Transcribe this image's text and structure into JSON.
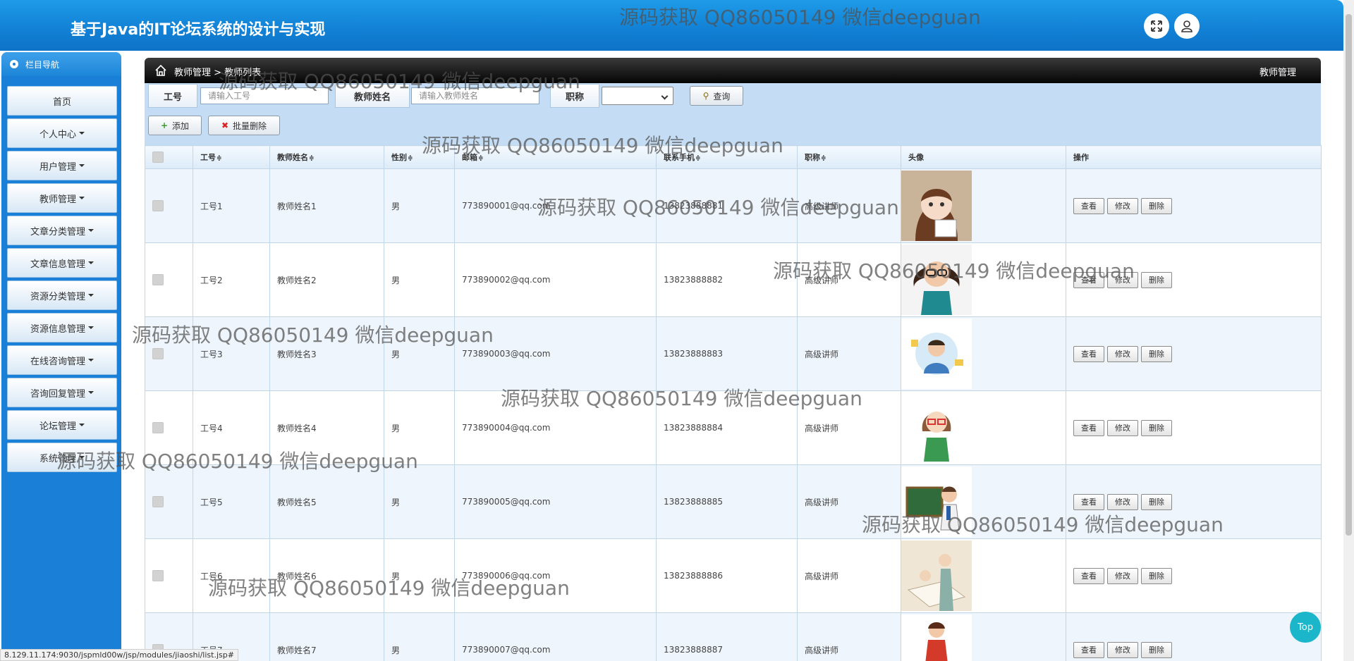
{
  "app": {
    "title": "基于Java的IT论坛系统的设计与实现"
  },
  "header": {
    "icons": [
      "expand-icon",
      "user-icon"
    ]
  },
  "sidebar": {
    "heading": "栏目导航",
    "items": [
      {
        "label": "首页",
        "has_caret": false
      },
      {
        "label": "个人中心",
        "has_caret": true
      },
      {
        "label": "用户管理",
        "has_caret": true
      },
      {
        "label": "教师管理",
        "has_caret": true
      },
      {
        "label": "文章分类管理",
        "has_caret": true
      },
      {
        "label": "文章信息管理",
        "has_caret": true
      },
      {
        "label": "资源分类管理",
        "has_caret": true
      },
      {
        "label": "资源信息管理",
        "has_caret": true
      },
      {
        "label": "在线咨询管理",
        "has_caret": true
      },
      {
        "label": "咨询回复管理",
        "has_caret": true
      },
      {
        "label": "论坛管理",
        "has_caret": true
      },
      {
        "label": "系统管理",
        "has_caret": true
      }
    ]
  },
  "breadcrumb": {
    "path": "教师管理 > 教师列表",
    "right": "教师管理"
  },
  "search": {
    "id_label": "工号",
    "id_placeholder": "请输入工号",
    "name_label": "教师姓名",
    "name_placeholder": "请输入教师姓名",
    "title_label": "职称",
    "title_value": "",
    "query_button": "查询",
    "add_button": "添加",
    "batch_delete_button": "批量删除"
  },
  "table": {
    "columns": [
      "工号",
      "教师姓名",
      "性别",
      "邮箱",
      "联系手机",
      "职称",
      "头像",
      "操作"
    ],
    "sort_symbol": "≑",
    "actions": {
      "view": "查看",
      "edit": "修改",
      "delete": "删除"
    },
    "rows": [
      {
        "id": "工号1",
        "name": "教师姓名1",
        "gender": "男",
        "email": "773890001@qq.com",
        "phone": "13823888881",
        "title": "高级讲师"
      },
      {
        "id": "工号2",
        "name": "教师姓名2",
        "gender": "男",
        "email": "773890002@qq.com",
        "phone": "13823888882",
        "title": "高级讲师"
      },
      {
        "id": "工号3",
        "name": "教师姓名3",
        "gender": "男",
        "email": "773890003@qq.com",
        "phone": "13823888883",
        "title": "高级讲师"
      },
      {
        "id": "工号4",
        "name": "教师姓名4",
        "gender": "男",
        "email": "773890004@qq.com",
        "phone": "13823888884",
        "title": "高级讲师"
      },
      {
        "id": "工号5",
        "name": "教师姓名5",
        "gender": "男",
        "email": "773890005@qq.com",
        "phone": "13823888885",
        "title": "高级讲师"
      },
      {
        "id": "工号6",
        "name": "教师姓名6",
        "gender": "男",
        "email": "773890006@qq.com",
        "phone": "13823888886",
        "title": "高级讲师"
      },
      {
        "id": "工号7",
        "name": "教师姓名7",
        "gender": "男",
        "email": "773890007@qq.com",
        "phone": "13823888887",
        "title": "高级讲师"
      }
    ]
  },
  "watermark_text": "源码获取 QQ86050149 微信deepguan",
  "status_url": "8.129.11.174:9030/jspmld00w/jsp/modules/jiaoshi/list.jsp#",
  "top_button": "Top",
  "colors": {
    "header_blue": "#1282d6",
    "sidebar_blue": "#1a7fd6",
    "search_bg": "#c4ddf5",
    "row_alt": "#eef5fc",
    "top_button": "#1bb6c9"
  }
}
